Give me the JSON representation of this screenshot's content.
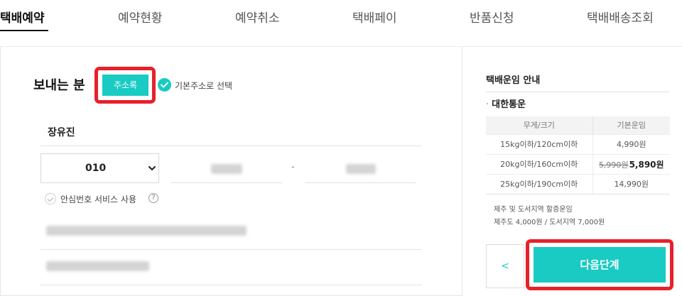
{
  "tabs": [
    {
      "label": "택배예약"
    },
    {
      "label": "예약현황"
    },
    {
      "label": "예약취소"
    },
    {
      "label": "택배페이"
    },
    {
      "label": "반품신청"
    },
    {
      "label": "택배배송조회"
    }
  ],
  "sender": {
    "title": "보내는 분",
    "address_book_label": "주소록",
    "default_address_label": "기본주소로 선택",
    "name": "장유진",
    "phone_prefix": "010",
    "phone_dash": "-",
    "safe_number_label": "안심번호 서비스 사용",
    "help_glyph": "?"
  },
  "fee_info": {
    "title": "택배운임 안내",
    "carrier_bullet": "·",
    "carrier": "대한통운",
    "headers": [
      "무게/크기",
      "기본운임"
    ],
    "rows": [
      {
        "size": "15kg이하/120cm이하",
        "fee": "4,990원"
      },
      {
        "size": "20kg이하/160cm이하",
        "fee_original": "5,990원",
        "fee_sale": "5,890원"
      },
      {
        "size": "25kg이하/190cm이하",
        "fee": "14,990원"
      }
    ],
    "note_title": "제주 및 도서지역 할증운임",
    "note_detail": "제주도 4,000원 / 도서지역 7,000원"
  },
  "actions": {
    "prev_label": "<",
    "next_label": "다음단계"
  },
  "colors": {
    "accent": "#19cbc3",
    "highlight_outline": "#e8202a"
  }
}
